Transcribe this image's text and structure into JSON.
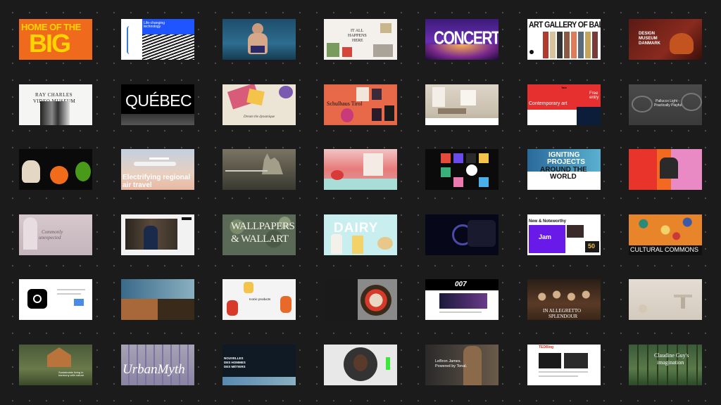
{
  "gallery": {
    "tiles": {
      "home_big": {
        "line1": "HOME OF THE",
        "line2": "BIG"
      },
      "life_changing": {
        "headline": "Life-changing\ntechnology"
      },
      "concerts": {
        "title": "CONCERTS"
      },
      "it_happens": {
        "line1": "IT ALL",
        "line2": "HAPPENS",
        "line3": "HERE"
      },
      "ballarat": {
        "title": "ART GALLERY OF BALLARAT"
      },
      "design_museum": {
        "line1": "DESIGN",
        "line2": "MUSEUM",
        "line3": "DANMARK"
      },
      "ray_charles": {
        "line1": "RAY CHARLES",
        "line2": "VIDEO MUSEUM"
      },
      "quebec": {
        "title": "QUÉBEC"
      },
      "dream_script": {
        "text": "Dream the dynamique"
      },
      "schulhaus": {
        "title": "Schulhaus Tirol"
      },
      "contemporary": {
        "title": "Contemporary art",
        "badge": "Free entry",
        "logo": "Tate"
      },
      "playful": {
        "line1": "Pallucco Light -",
        "line2": "Practically Playful"
      },
      "electrifying": {
        "line1": "Electrifying regional",
        "line2": "air travel"
      },
      "igniting": {
        "line1": "IGNITING",
        "line2": "PROJECTS",
        "line3": "AROUND THE",
        "line4": "WORLD"
      },
      "unexpected": {
        "line1": "Commonly",
        "line2": "unexpected"
      },
      "wallpapers": {
        "line1": "WALLPAPERS",
        "line2": "& WALLART"
      },
      "dairy": {
        "title": "DAIRY"
      },
      "new_noteworthy": {
        "title": "New & Noteworthy",
        "item": "Jam",
        "badge": "50"
      },
      "cultural": {
        "title": "CULTURAL COMMONS"
      },
      "iconic_products": {
        "title": "Iconic products"
      },
      "bond": {
        "logo": "007"
      },
      "lagrange": {
        "line1": "IN ALLEGRETTO",
        "line2": "SPLENDOUR"
      },
      "cabin": {
        "text": "Sustainable living in\nharmony with nature"
      },
      "urban": {
        "title": "UrbanMyth"
      },
      "bold_words": {
        "line1": "NOUVELLES",
        "line2": "DES HOMMES",
        "line3": "DES MÉTIERS"
      },
      "lebron": {
        "line1": "LeBron James.",
        "line2": "Powered by Tonal."
      },
      "ted": {
        "logo": "TEDBlog"
      },
      "forest": {
        "line1": "Claudine Guy's",
        "line2": "imagination"
      }
    }
  }
}
